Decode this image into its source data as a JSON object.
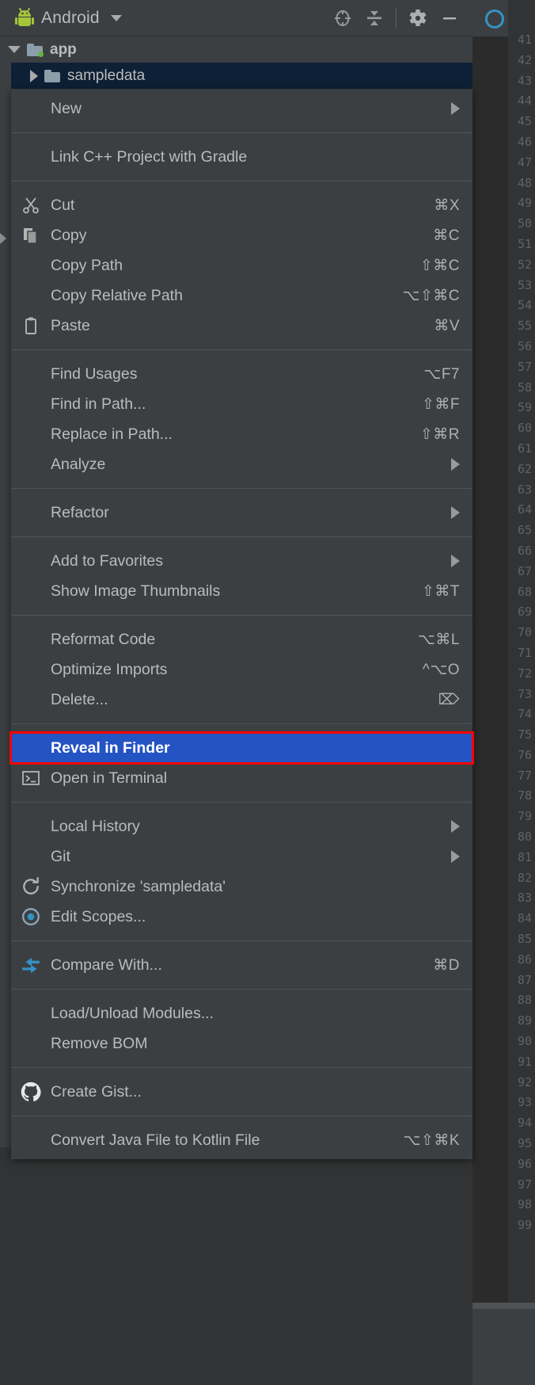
{
  "toolwindow": {
    "title": "Android",
    "caret_icon": "chevron-down-icon",
    "logo_icon": "android-robot-icon",
    "actions": [
      {
        "name": "select-opened-file-button",
        "icon": "crosshair-target-icon"
      },
      {
        "name": "collapse-all-button",
        "icon": "collapse-all-icon"
      },
      {
        "name": "settings-button",
        "icon": "gear-icon"
      },
      {
        "name": "hide-button",
        "icon": "minimize-icon"
      }
    ]
  },
  "tree": {
    "rows": [
      {
        "label": "app",
        "expanded": true,
        "selected": false,
        "icon": "module-folder-icon"
      },
      {
        "label": "sampledata",
        "expanded": false,
        "selected": true,
        "icon": "folder-icon"
      }
    ]
  },
  "context_menu": {
    "groups": [
      {
        "items": [
          {
            "label": "New",
            "shortcut": "",
            "icon": "",
            "submenu": true,
            "selected": false
          }
        ]
      },
      {
        "items": [
          {
            "label": "Link C++ Project with Gradle",
            "shortcut": "",
            "icon": "",
            "submenu": false,
            "selected": false
          }
        ]
      },
      {
        "items": [
          {
            "label": "Cut",
            "shortcut": "⌘X",
            "icon": "scissors-icon",
            "submenu": false,
            "selected": false
          },
          {
            "label": "Copy",
            "shortcut": "⌘C",
            "icon": "copy-icon",
            "submenu": false,
            "selected": false
          },
          {
            "label": "Copy Path",
            "shortcut": "⇧⌘C",
            "icon": "",
            "submenu": false,
            "selected": false
          },
          {
            "label": "Copy Relative Path",
            "shortcut": "⌥⇧⌘C",
            "icon": "",
            "submenu": false,
            "selected": false
          },
          {
            "label": "Paste",
            "shortcut": "⌘V",
            "icon": "clipboard-icon",
            "submenu": false,
            "selected": false
          }
        ]
      },
      {
        "items": [
          {
            "label": "Find Usages",
            "shortcut": "⌥F7",
            "icon": "",
            "submenu": false,
            "selected": false
          },
          {
            "label": "Find in Path...",
            "shortcut": "⇧⌘F",
            "icon": "",
            "submenu": false,
            "selected": false
          },
          {
            "label": "Replace in Path...",
            "shortcut": "⇧⌘R",
            "icon": "",
            "submenu": false,
            "selected": false
          },
          {
            "label": "Analyze",
            "shortcut": "",
            "icon": "",
            "submenu": true,
            "selected": false
          }
        ]
      },
      {
        "items": [
          {
            "label": "Refactor",
            "shortcut": "",
            "icon": "",
            "submenu": true,
            "selected": false
          }
        ]
      },
      {
        "items": [
          {
            "label": "Add to Favorites",
            "shortcut": "",
            "icon": "",
            "submenu": true,
            "selected": false
          },
          {
            "label": "Show Image Thumbnails",
            "shortcut": "⇧⌘T",
            "icon": "",
            "submenu": false,
            "selected": false
          }
        ]
      },
      {
        "items": [
          {
            "label": "Reformat Code",
            "shortcut": "⌥⌘L",
            "icon": "",
            "submenu": false,
            "selected": false
          },
          {
            "label": "Optimize Imports",
            "shortcut": "^⌥O",
            "icon": "",
            "submenu": false,
            "selected": false
          },
          {
            "label": "Delete...",
            "shortcut": "⌦",
            "icon": "",
            "submenu": false,
            "selected": false
          }
        ]
      },
      {
        "items": [
          {
            "label": "Reveal in Finder",
            "shortcut": "",
            "icon": "",
            "submenu": false,
            "selected": true
          },
          {
            "label": "Open in Terminal",
            "shortcut": "",
            "icon": "terminal-icon",
            "submenu": false,
            "selected": false
          }
        ]
      },
      {
        "items": [
          {
            "label": "Local History",
            "shortcut": "",
            "icon": "",
            "submenu": true,
            "selected": false
          },
          {
            "label": "Git",
            "shortcut": "",
            "icon": "",
            "submenu": true,
            "selected": false
          },
          {
            "label": "Synchronize 'sampledata'",
            "shortcut": "",
            "icon": "refresh-icon",
            "submenu": false,
            "selected": false
          },
          {
            "label": "Edit Scopes...",
            "shortcut": "",
            "icon": "scope-target-icon",
            "submenu": false,
            "selected": false
          }
        ]
      },
      {
        "items": [
          {
            "label": "Compare With...",
            "shortcut": "⌘D",
            "icon": "compare-arrows-icon",
            "submenu": false,
            "selected": false
          }
        ]
      },
      {
        "items": [
          {
            "label": "Load/Unload Modules...",
            "shortcut": "",
            "icon": "",
            "submenu": false,
            "selected": false
          },
          {
            "label": "Remove BOM",
            "shortcut": "",
            "icon": "",
            "submenu": false,
            "selected": false
          }
        ]
      },
      {
        "items": [
          {
            "label": "Create Gist...",
            "shortcut": "",
            "icon": "github-icon",
            "submenu": false,
            "selected": false
          }
        ]
      },
      {
        "items": [
          {
            "label": "Convert Java File to Kotlin File",
            "shortcut": "⌥⇧⌘K",
            "icon": "",
            "submenu": false,
            "selected": false
          }
        ]
      }
    ]
  },
  "editor": {
    "line_numbers": [
      "41",
      "42",
      "43",
      "44",
      "45",
      "46",
      "47",
      "48",
      "49",
      "50",
      "51",
      "52",
      "53",
      "54",
      "55",
      "56",
      "57",
      "58",
      "59",
      "60",
      "61",
      "62",
      "63",
      "64",
      "65",
      "66",
      "67",
      "68",
      "69",
      "70",
      "71",
      "72",
      "73",
      "74",
      "75",
      "76",
      "77",
      "78",
      "79",
      "80",
      "81",
      "82",
      "83",
      "84",
      "85",
      "86",
      "87",
      "88",
      "89",
      "90",
      "91",
      "92",
      "93",
      "94",
      "95",
      "96",
      "97",
      "98",
      "99"
    ]
  },
  "colors": {
    "menu_bg": "#3c3f41",
    "selection_blue": "#2453c4",
    "highlight_red": "#ff0000",
    "accent_green": "#a4c639",
    "accent_blue": "#3592c4",
    "text": "#bbbbbb"
  }
}
